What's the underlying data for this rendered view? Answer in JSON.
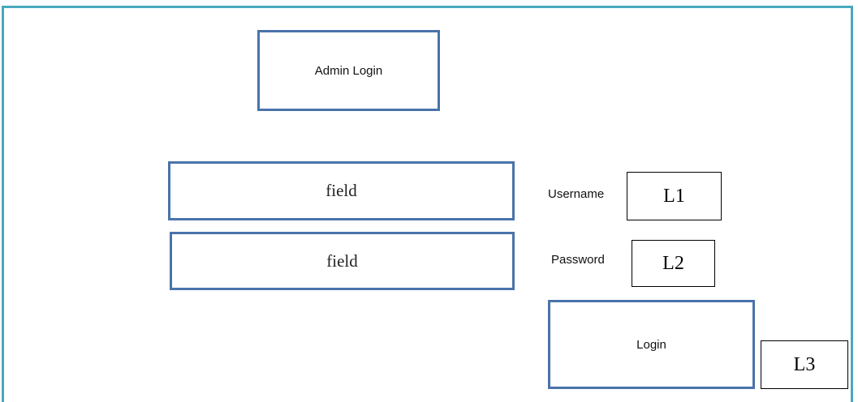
{
  "header": {
    "title": "Admin Login"
  },
  "form": {
    "username_field_placeholder": "field",
    "password_field_placeholder": "field",
    "username_label": "Username",
    "password_label": "Password",
    "login_button_label": "Login"
  },
  "annotations": {
    "l1": "L1",
    "l2": "L2",
    "l3": "L3"
  },
  "colors": {
    "frame_border": "#4aa8bd",
    "box_border": "#4a73aa",
    "tag_border": "#000000"
  }
}
